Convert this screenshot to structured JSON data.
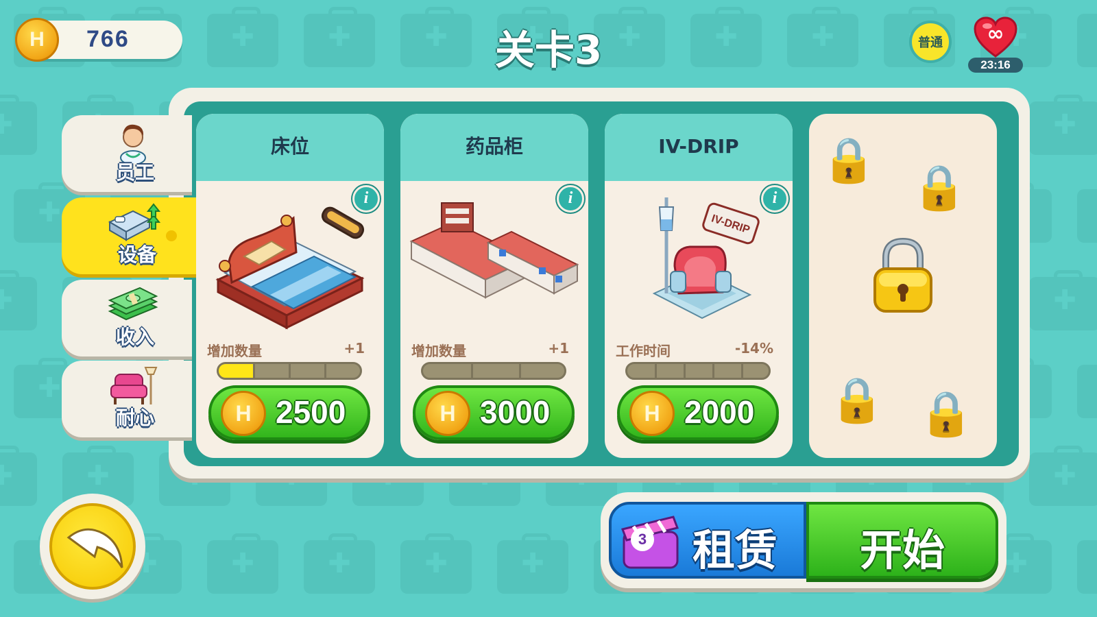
{
  "header": {
    "coins": "766",
    "coin_symbol": "H",
    "level_title": "关卡3",
    "difficulty": "普通",
    "lives_symbol": "∞",
    "lives_timer": "23:16"
  },
  "sidebar": {
    "items": [
      {
        "label": "员工",
        "icon": "doctor-icon"
      },
      {
        "label": "设备",
        "icon": "bed-upgrade-icon",
        "active": true
      },
      {
        "label": "收入",
        "icon": "cash-icon"
      },
      {
        "label": "耐心",
        "icon": "armchair-icon"
      }
    ]
  },
  "cards": [
    {
      "title": "床位",
      "stat_label": "增加数量",
      "stat_value": "+1",
      "progress": 0.25,
      "price": "2500",
      "coin_symbol": "H",
      "info": "i"
    },
    {
      "title": "药品柜",
      "stat_label": "增加数量",
      "stat_value": "+1",
      "progress": 0,
      "price": "3000",
      "coin_symbol": "H",
      "info": "i"
    },
    {
      "title": "IV-DRIP",
      "stat_label": "工作时间",
      "stat_value": "-14%",
      "progress": 0,
      "price": "2000",
      "coin_symbol": "H",
      "info": "i",
      "art_label": "IV-DRIP"
    },
    {
      "locked": true
    }
  ],
  "footer": {
    "rent_label": "租赁",
    "rent_count": "3",
    "start_label": "开始"
  },
  "colors": {
    "background": "#5ccfc7",
    "panel": "#2a9f92",
    "buy_green": "#32b51c",
    "rent_blue": "#1a7ad8",
    "active_tab": "#ffe21d",
    "progress_fill": "#ffe617"
  }
}
